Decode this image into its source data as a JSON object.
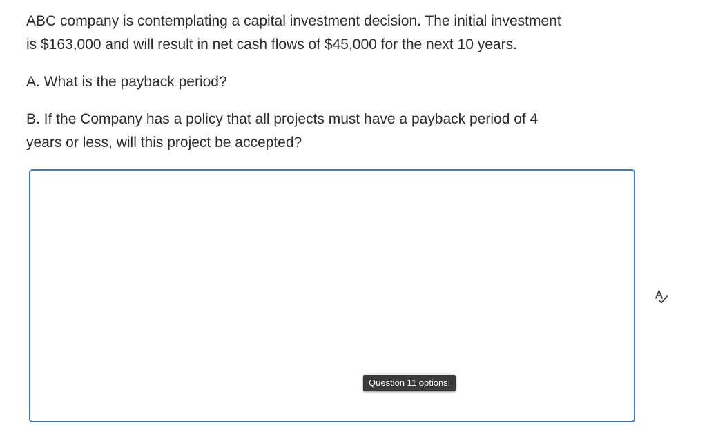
{
  "question": {
    "intro_line1": "ABC company is contemplating a capital investment decision.  The initial investment",
    "intro_line2": "is $163,000 and will result in net cash flows of $45,000 for the next 10 years.",
    "part_a": "A. What is the payback period?",
    "part_b_line1": "B. If the Company has a policy that all projects must have a payback period of 4",
    "part_b_line2": "years or less, will this project be accepted?"
  },
  "answer": {
    "value": "",
    "options_label": "Question 11 options:"
  },
  "icons": {
    "spellcheck": "spellcheck-icon"
  },
  "colors": {
    "text": "#2d2d2d",
    "box_border": "#3c7ec2",
    "tooltip_bg": "#3a3a3a"
  }
}
